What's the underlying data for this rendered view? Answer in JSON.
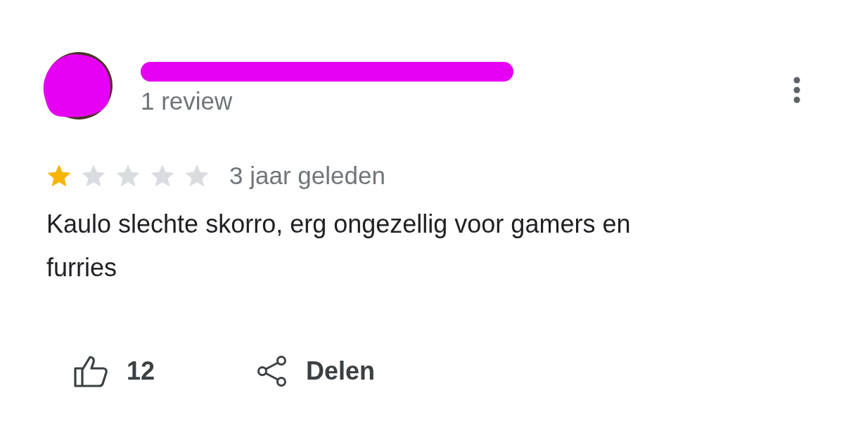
{
  "reviewer": {
    "review_count": "1 review"
  },
  "review": {
    "stars": 1,
    "time": "3 jaar geleden",
    "text": "Kaulo slechte skorro, erg ongezellig voor gamers en furries"
  },
  "actions": {
    "likes": "12",
    "share": "Delen"
  }
}
